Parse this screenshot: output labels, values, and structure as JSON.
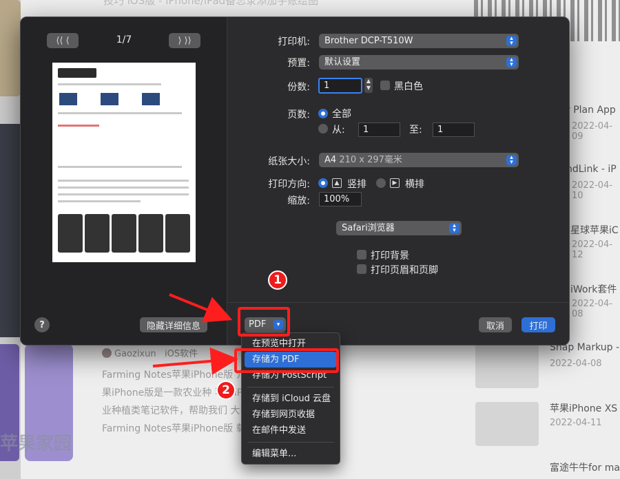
{
  "background": {
    "top_title": "技巧 iOS版 - iPhone/iPad备忘录添加手账绘图",
    "right_items": [
      {
        "title": "r Plan App",
        "date": "2022-04-09"
      },
      {
        "title": "ndLink - iP",
        "date": "2022-04-10"
      },
      {
        "title": "星球苹果iC",
        "date": "2022-04-12"
      },
      {
        "title": "iWork套件",
        "date": "2022-04-08"
      },
      {
        "title": "Snap Markup -",
        "date": "2022-04-08"
      },
      {
        "title": "苹果iPhone XS",
        "date": "2022-04-11"
      },
      {
        "title": "富途牛牛for ma",
        "date": ""
      }
    ],
    "author": "Gaozixun",
    "category": "iOS软件",
    "paragraph": [
      "Farming Notes苹果iPhone版 介 Farming Notes苹",
      "果iPhone版是一款农业种 苹果iPhone设计的以农",
      "业种植类笔记软件，帮助我们 大田喷洒和大田施肥。",
      "Farming Notes苹果iPhone版 载"
    ],
    "watermark": "苹果家园"
  },
  "dialog": {
    "page_indicator": "1/7",
    "nav_prev": "⟨⟨ ⟨",
    "nav_next": "⟩ ⟩⟩",
    "printer": {
      "label": "打印机:",
      "value": "Brother DCP-T510W"
    },
    "preset": {
      "label": "预置:",
      "value": "默认设置"
    },
    "copies": {
      "label": "份数:",
      "value": "1",
      "bw_label": "黑白色"
    },
    "pages": {
      "label": "页数:",
      "all": "全部",
      "from": "从:",
      "from_value": "1",
      "to": "至:",
      "to_value": "1"
    },
    "paper_size": {
      "label": "纸张大小:",
      "value": "A4",
      "detail": "210 x 297毫米"
    },
    "orientation": {
      "label": "打印方向:",
      "portrait": "竖排",
      "landscape": "横排"
    },
    "scale": {
      "label": "缩放:",
      "value": "100%"
    },
    "section_select": "Safari浏览器",
    "print_backgrounds": "打印背景",
    "print_headers": "打印页眉和页脚",
    "help": "?",
    "hide_details": "隐藏详细信息",
    "pdf": "PDF",
    "cancel": "取消",
    "print": "打印"
  },
  "pdf_menu": {
    "items": [
      "在预览中打开",
      "存储为 PDF",
      "存储为 PostScript",
      "存储到 iCloud 云盘",
      "存储到网页收据",
      "在邮件中发送"
    ],
    "edit": "编辑菜单...",
    "highlighted_index": 1
  },
  "annotations": {
    "step1": "1",
    "step2": "2",
    "color": "#ff1e1e"
  }
}
